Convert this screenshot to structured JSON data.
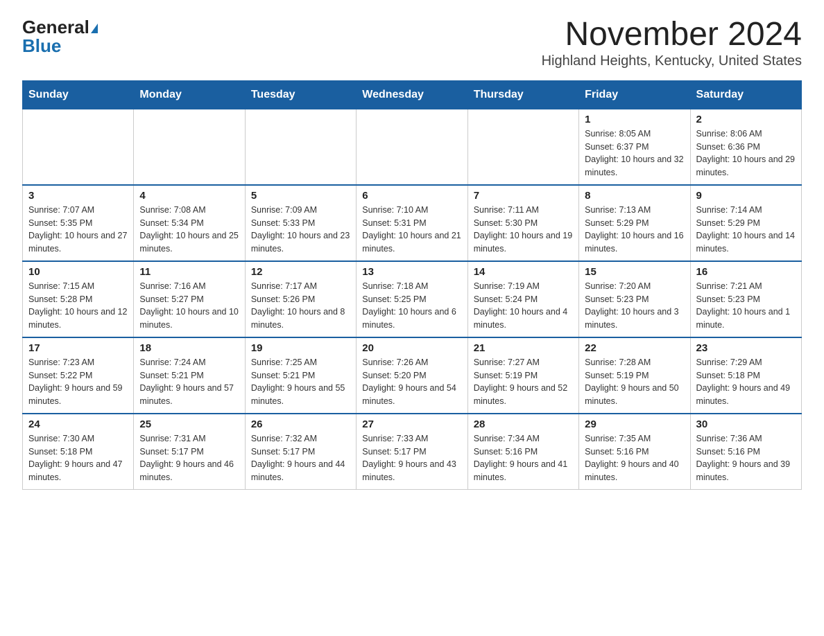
{
  "logo": {
    "text_general": "General",
    "text_blue": "Blue"
  },
  "title": {
    "month_year": "November 2024",
    "location": "Highland Heights, Kentucky, United States"
  },
  "weekdays": [
    "Sunday",
    "Monday",
    "Tuesday",
    "Wednesday",
    "Thursday",
    "Friday",
    "Saturday"
  ],
  "weeks": [
    [
      {
        "day": "",
        "sunrise": "",
        "sunset": "",
        "daylight": ""
      },
      {
        "day": "",
        "sunrise": "",
        "sunset": "",
        "daylight": ""
      },
      {
        "day": "",
        "sunrise": "",
        "sunset": "",
        "daylight": ""
      },
      {
        "day": "",
        "sunrise": "",
        "sunset": "",
        "daylight": ""
      },
      {
        "day": "",
        "sunrise": "",
        "sunset": "",
        "daylight": ""
      },
      {
        "day": "1",
        "sunrise": "Sunrise: 8:05 AM",
        "sunset": "Sunset: 6:37 PM",
        "daylight": "Daylight: 10 hours and 32 minutes."
      },
      {
        "day": "2",
        "sunrise": "Sunrise: 8:06 AM",
        "sunset": "Sunset: 6:36 PM",
        "daylight": "Daylight: 10 hours and 29 minutes."
      }
    ],
    [
      {
        "day": "3",
        "sunrise": "Sunrise: 7:07 AM",
        "sunset": "Sunset: 5:35 PM",
        "daylight": "Daylight: 10 hours and 27 minutes."
      },
      {
        "day": "4",
        "sunrise": "Sunrise: 7:08 AM",
        "sunset": "Sunset: 5:34 PM",
        "daylight": "Daylight: 10 hours and 25 minutes."
      },
      {
        "day": "5",
        "sunrise": "Sunrise: 7:09 AM",
        "sunset": "Sunset: 5:33 PM",
        "daylight": "Daylight: 10 hours and 23 minutes."
      },
      {
        "day": "6",
        "sunrise": "Sunrise: 7:10 AM",
        "sunset": "Sunset: 5:31 PM",
        "daylight": "Daylight: 10 hours and 21 minutes."
      },
      {
        "day": "7",
        "sunrise": "Sunrise: 7:11 AM",
        "sunset": "Sunset: 5:30 PM",
        "daylight": "Daylight: 10 hours and 19 minutes."
      },
      {
        "day": "8",
        "sunrise": "Sunrise: 7:13 AM",
        "sunset": "Sunset: 5:29 PM",
        "daylight": "Daylight: 10 hours and 16 minutes."
      },
      {
        "day": "9",
        "sunrise": "Sunrise: 7:14 AM",
        "sunset": "Sunset: 5:29 PM",
        "daylight": "Daylight: 10 hours and 14 minutes."
      }
    ],
    [
      {
        "day": "10",
        "sunrise": "Sunrise: 7:15 AM",
        "sunset": "Sunset: 5:28 PM",
        "daylight": "Daylight: 10 hours and 12 minutes."
      },
      {
        "day": "11",
        "sunrise": "Sunrise: 7:16 AM",
        "sunset": "Sunset: 5:27 PM",
        "daylight": "Daylight: 10 hours and 10 minutes."
      },
      {
        "day": "12",
        "sunrise": "Sunrise: 7:17 AM",
        "sunset": "Sunset: 5:26 PM",
        "daylight": "Daylight: 10 hours and 8 minutes."
      },
      {
        "day": "13",
        "sunrise": "Sunrise: 7:18 AM",
        "sunset": "Sunset: 5:25 PM",
        "daylight": "Daylight: 10 hours and 6 minutes."
      },
      {
        "day": "14",
        "sunrise": "Sunrise: 7:19 AM",
        "sunset": "Sunset: 5:24 PM",
        "daylight": "Daylight: 10 hours and 4 minutes."
      },
      {
        "day": "15",
        "sunrise": "Sunrise: 7:20 AM",
        "sunset": "Sunset: 5:23 PM",
        "daylight": "Daylight: 10 hours and 3 minutes."
      },
      {
        "day": "16",
        "sunrise": "Sunrise: 7:21 AM",
        "sunset": "Sunset: 5:23 PM",
        "daylight": "Daylight: 10 hours and 1 minute."
      }
    ],
    [
      {
        "day": "17",
        "sunrise": "Sunrise: 7:23 AM",
        "sunset": "Sunset: 5:22 PM",
        "daylight": "Daylight: 9 hours and 59 minutes."
      },
      {
        "day": "18",
        "sunrise": "Sunrise: 7:24 AM",
        "sunset": "Sunset: 5:21 PM",
        "daylight": "Daylight: 9 hours and 57 minutes."
      },
      {
        "day": "19",
        "sunrise": "Sunrise: 7:25 AM",
        "sunset": "Sunset: 5:21 PM",
        "daylight": "Daylight: 9 hours and 55 minutes."
      },
      {
        "day": "20",
        "sunrise": "Sunrise: 7:26 AM",
        "sunset": "Sunset: 5:20 PM",
        "daylight": "Daylight: 9 hours and 54 minutes."
      },
      {
        "day": "21",
        "sunrise": "Sunrise: 7:27 AM",
        "sunset": "Sunset: 5:19 PM",
        "daylight": "Daylight: 9 hours and 52 minutes."
      },
      {
        "day": "22",
        "sunrise": "Sunrise: 7:28 AM",
        "sunset": "Sunset: 5:19 PM",
        "daylight": "Daylight: 9 hours and 50 minutes."
      },
      {
        "day": "23",
        "sunrise": "Sunrise: 7:29 AM",
        "sunset": "Sunset: 5:18 PM",
        "daylight": "Daylight: 9 hours and 49 minutes."
      }
    ],
    [
      {
        "day": "24",
        "sunrise": "Sunrise: 7:30 AM",
        "sunset": "Sunset: 5:18 PM",
        "daylight": "Daylight: 9 hours and 47 minutes."
      },
      {
        "day": "25",
        "sunrise": "Sunrise: 7:31 AM",
        "sunset": "Sunset: 5:17 PM",
        "daylight": "Daylight: 9 hours and 46 minutes."
      },
      {
        "day": "26",
        "sunrise": "Sunrise: 7:32 AM",
        "sunset": "Sunset: 5:17 PM",
        "daylight": "Daylight: 9 hours and 44 minutes."
      },
      {
        "day": "27",
        "sunrise": "Sunrise: 7:33 AM",
        "sunset": "Sunset: 5:17 PM",
        "daylight": "Daylight: 9 hours and 43 minutes."
      },
      {
        "day": "28",
        "sunrise": "Sunrise: 7:34 AM",
        "sunset": "Sunset: 5:16 PM",
        "daylight": "Daylight: 9 hours and 41 minutes."
      },
      {
        "day": "29",
        "sunrise": "Sunrise: 7:35 AM",
        "sunset": "Sunset: 5:16 PM",
        "daylight": "Daylight: 9 hours and 40 minutes."
      },
      {
        "day": "30",
        "sunrise": "Sunrise: 7:36 AM",
        "sunset": "Sunset: 5:16 PM",
        "daylight": "Daylight: 9 hours and 39 minutes."
      }
    ]
  ]
}
